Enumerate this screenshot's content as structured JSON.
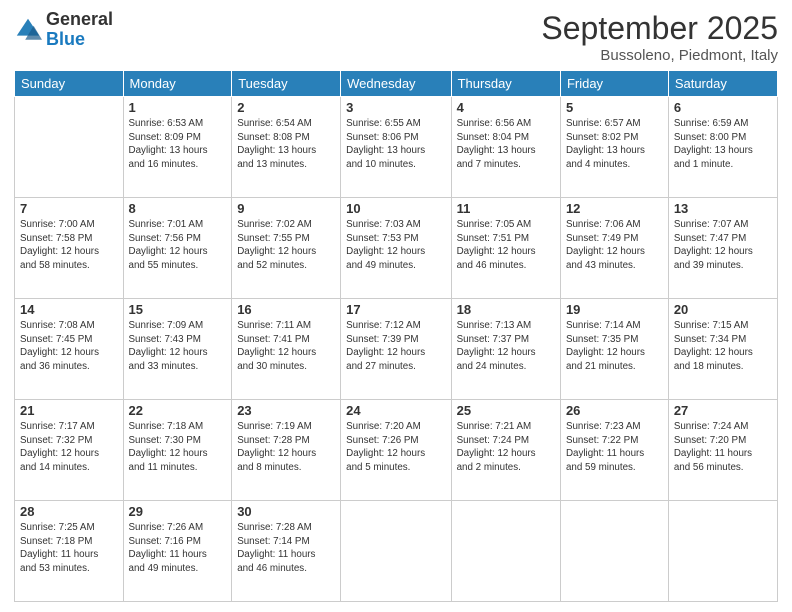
{
  "logo": {
    "general": "General",
    "blue": "Blue"
  },
  "title": {
    "month": "September 2025",
    "location": "Bussoleno, Piedmont, Italy"
  },
  "headers": [
    "Sunday",
    "Monday",
    "Tuesday",
    "Wednesday",
    "Thursday",
    "Friday",
    "Saturday"
  ],
  "weeks": [
    [
      {
        "day": "",
        "info": ""
      },
      {
        "day": "1",
        "info": "Sunrise: 6:53 AM\nSunset: 8:09 PM\nDaylight: 13 hours\nand 16 minutes."
      },
      {
        "day": "2",
        "info": "Sunrise: 6:54 AM\nSunset: 8:08 PM\nDaylight: 13 hours\nand 13 minutes."
      },
      {
        "day": "3",
        "info": "Sunrise: 6:55 AM\nSunset: 8:06 PM\nDaylight: 13 hours\nand 10 minutes."
      },
      {
        "day": "4",
        "info": "Sunrise: 6:56 AM\nSunset: 8:04 PM\nDaylight: 13 hours\nand 7 minutes."
      },
      {
        "day": "5",
        "info": "Sunrise: 6:57 AM\nSunset: 8:02 PM\nDaylight: 13 hours\nand 4 minutes."
      },
      {
        "day": "6",
        "info": "Sunrise: 6:59 AM\nSunset: 8:00 PM\nDaylight: 13 hours\nand 1 minute."
      }
    ],
    [
      {
        "day": "7",
        "info": "Sunrise: 7:00 AM\nSunset: 7:58 PM\nDaylight: 12 hours\nand 58 minutes."
      },
      {
        "day": "8",
        "info": "Sunrise: 7:01 AM\nSunset: 7:56 PM\nDaylight: 12 hours\nand 55 minutes."
      },
      {
        "day": "9",
        "info": "Sunrise: 7:02 AM\nSunset: 7:55 PM\nDaylight: 12 hours\nand 52 minutes."
      },
      {
        "day": "10",
        "info": "Sunrise: 7:03 AM\nSunset: 7:53 PM\nDaylight: 12 hours\nand 49 minutes."
      },
      {
        "day": "11",
        "info": "Sunrise: 7:05 AM\nSunset: 7:51 PM\nDaylight: 12 hours\nand 46 minutes."
      },
      {
        "day": "12",
        "info": "Sunrise: 7:06 AM\nSunset: 7:49 PM\nDaylight: 12 hours\nand 43 minutes."
      },
      {
        "day": "13",
        "info": "Sunrise: 7:07 AM\nSunset: 7:47 PM\nDaylight: 12 hours\nand 39 minutes."
      }
    ],
    [
      {
        "day": "14",
        "info": "Sunrise: 7:08 AM\nSunset: 7:45 PM\nDaylight: 12 hours\nand 36 minutes."
      },
      {
        "day": "15",
        "info": "Sunrise: 7:09 AM\nSunset: 7:43 PM\nDaylight: 12 hours\nand 33 minutes."
      },
      {
        "day": "16",
        "info": "Sunrise: 7:11 AM\nSunset: 7:41 PM\nDaylight: 12 hours\nand 30 minutes."
      },
      {
        "day": "17",
        "info": "Sunrise: 7:12 AM\nSunset: 7:39 PM\nDaylight: 12 hours\nand 27 minutes."
      },
      {
        "day": "18",
        "info": "Sunrise: 7:13 AM\nSunset: 7:37 PM\nDaylight: 12 hours\nand 24 minutes."
      },
      {
        "day": "19",
        "info": "Sunrise: 7:14 AM\nSunset: 7:35 PM\nDaylight: 12 hours\nand 21 minutes."
      },
      {
        "day": "20",
        "info": "Sunrise: 7:15 AM\nSunset: 7:34 PM\nDaylight: 12 hours\nand 18 minutes."
      }
    ],
    [
      {
        "day": "21",
        "info": "Sunrise: 7:17 AM\nSunset: 7:32 PM\nDaylight: 12 hours\nand 14 minutes."
      },
      {
        "day": "22",
        "info": "Sunrise: 7:18 AM\nSunset: 7:30 PM\nDaylight: 12 hours\nand 11 minutes."
      },
      {
        "day": "23",
        "info": "Sunrise: 7:19 AM\nSunset: 7:28 PM\nDaylight: 12 hours\nand 8 minutes."
      },
      {
        "day": "24",
        "info": "Sunrise: 7:20 AM\nSunset: 7:26 PM\nDaylight: 12 hours\nand 5 minutes."
      },
      {
        "day": "25",
        "info": "Sunrise: 7:21 AM\nSunset: 7:24 PM\nDaylight: 12 hours\nand 2 minutes."
      },
      {
        "day": "26",
        "info": "Sunrise: 7:23 AM\nSunset: 7:22 PM\nDaylight: 11 hours\nand 59 minutes."
      },
      {
        "day": "27",
        "info": "Sunrise: 7:24 AM\nSunset: 7:20 PM\nDaylight: 11 hours\nand 56 minutes."
      }
    ],
    [
      {
        "day": "28",
        "info": "Sunrise: 7:25 AM\nSunset: 7:18 PM\nDaylight: 11 hours\nand 53 minutes."
      },
      {
        "day": "29",
        "info": "Sunrise: 7:26 AM\nSunset: 7:16 PM\nDaylight: 11 hours\nand 49 minutes."
      },
      {
        "day": "30",
        "info": "Sunrise: 7:28 AM\nSunset: 7:14 PM\nDaylight: 11 hours\nand 46 minutes."
      },
      {
        "day": "",
        "info": ""
      },
      {
        "day": "",
        "info": ""
      },
      {
        "day": "",
        "info": ""
      },
      {
        "day": "",
        "info": ""
      }
    ]
  ]
}
